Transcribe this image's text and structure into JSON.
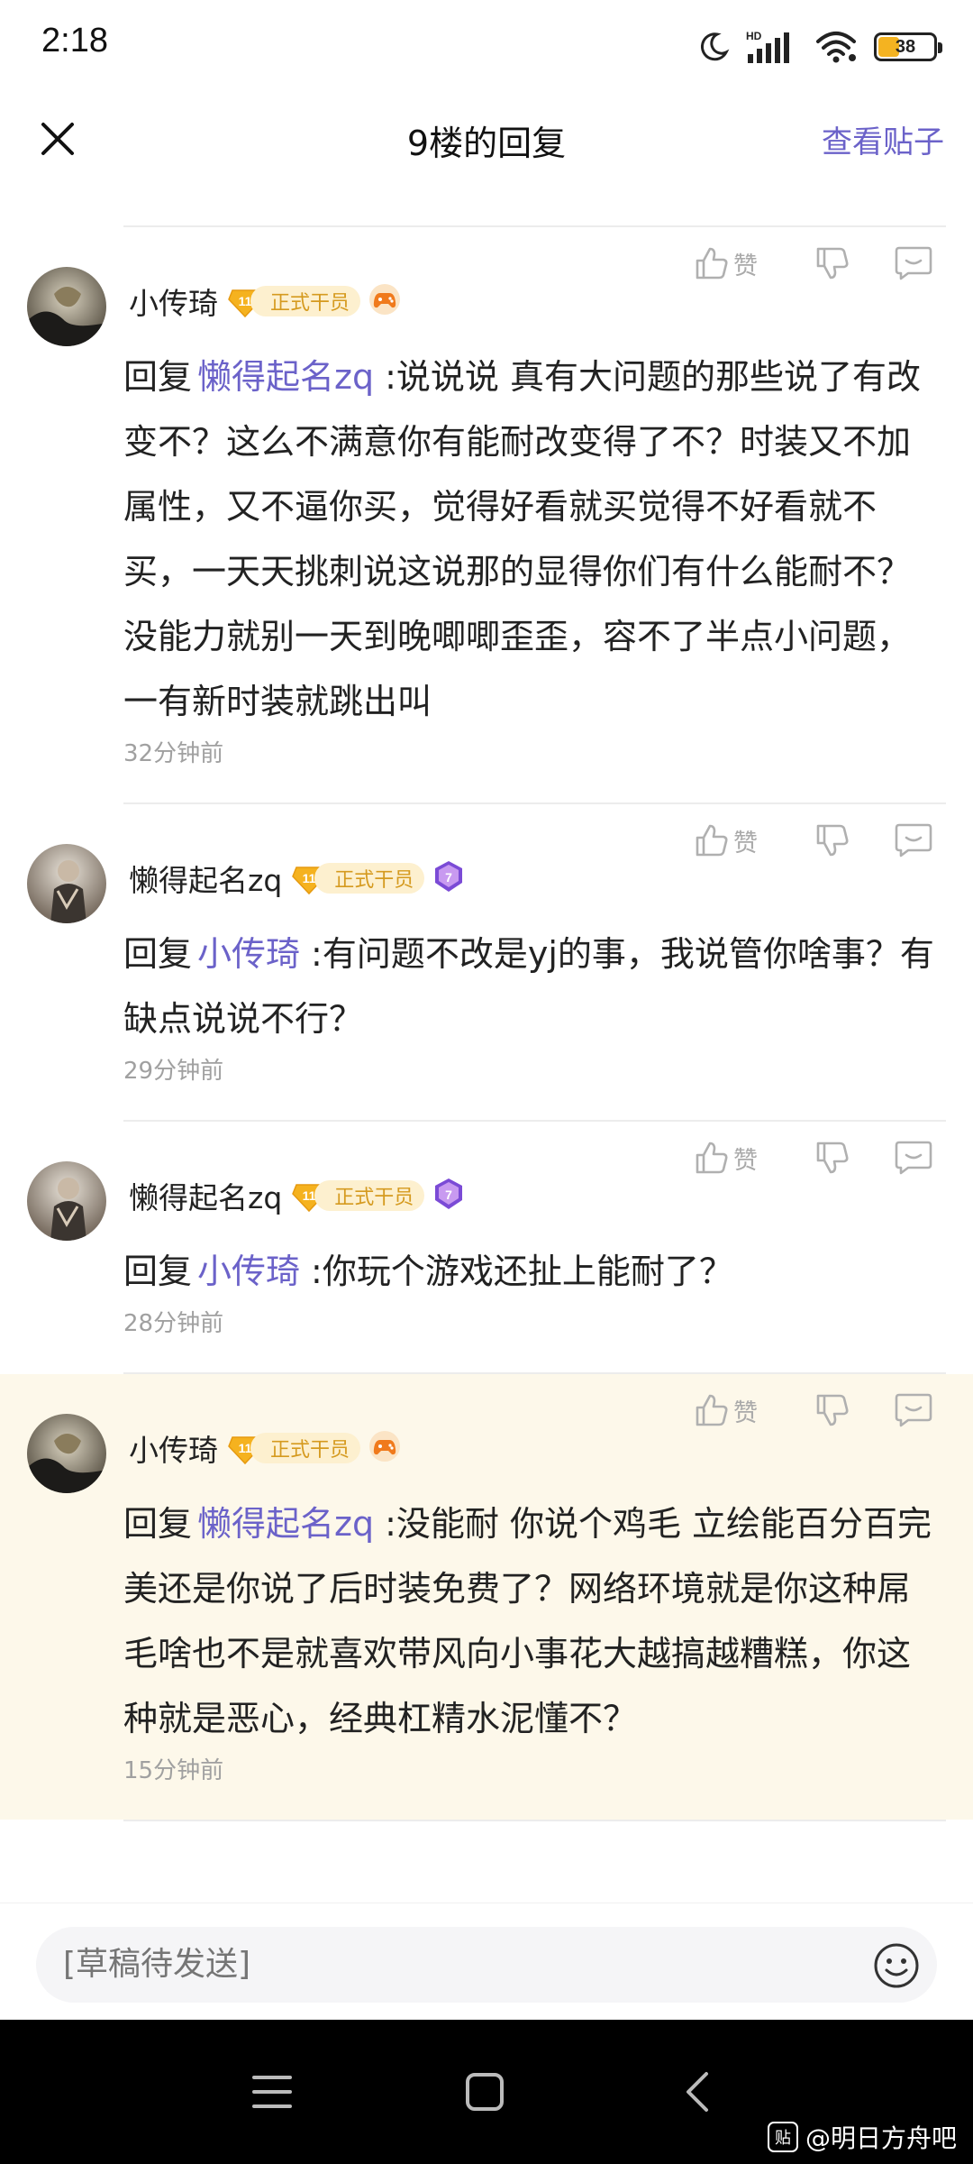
{
  "status_bar": {
    "time": "2:18",
    "network_label": "HD",
    "battery": "38",
    "battery_level": 0.38,
    "icons": [
      "moon-icon",
      "hd-signal-icon",
      "wifi-icon",
      "battery-icon"
    ]
  },
  "nav": {
    "title": "9楼的回复",
    "view_post": "查看贴子",
    "close_icon": "close-icon"
  },
  "replies": [
    {
      "username": "小传琦",
      "level": "11",
      "title_badge": "正式干员",
      "medal_icon": "gamepad-medal-icon",
      "reply_prefix": "回复",
      "mention": "懒得起名zq",
      "text": ":说说说 真有大问题的那些说了有改变不？这么不满意你有能耐改变得了不？时装又不加属性，又不逼你买，觉得好看就买觉得不好看就不买，一天天挑刺说这说那的显得你们有什么能耐不？没能力就别一天到晚唧唧歪歪，容不了半点小问题，一有新时装就跳出叫",
      "time": "32分钟前",
      "like_label": "赞"
    },
    {
      "username": "懒得起名zq",
      "level": "11",
      "title_badge": "正式干员",
      "medal_level": "7",
      "medal_icon": "level-7-medal-icon",
      "reply_prefix": "回复",
      "mention": "小传琦",
      "text": ":有问题不改是yj的事，我说管你啥事？有缺点说说不行？",
      "time": "29分钟前",
      "like_label": "赞"
    },
    {
      "username": "懒得起名zq",
      "level": "11",
      "title_badge": "正式干员",
      "medal_level": "7",
      "medal_icon": "level-7-medal-icon",
      "reply_prefix": "回复",
      "mention": "小传琦",
      "text": ":你玩个游戏还扯上能耐了？",
      "time": "28分钟前",
      "like_label": "赞"
    },
    {
      "username": "小传琦",
      "level": "11",
      "title_badge": "正式干员",
      "medal_icon": "gamepad-medal-icon",
      "reply_prefix": "回复",
      "mention": "懒得起名zq",
      "text": ":没能耐 你说个鸡毛 立绘能百分百完美还是你说了后时装免费了？网络环境就是你这种屌毛啥也不是就喜欢带风向小事花大越搞越糟糕，你这种就是恶心，经典杠精水泥懂不？",
      "time": "15分钟前",
      "like_label": "赞",
      "highlighted": true
    }
  ],
  "composer": {
    "placeholder": "[草稿待发送]",
    "emoji_icon": "emoji-icon"
  },
  "system_nav": {
    "icons": [
      "menu-icon",
      "home-icon",
      "back-icon"
    ]
  },
  "watermark": {
    "logo": "贴",
    "text": "@明日方舟吧"
  },
  "colors": {
    "accent": "#6b62c9",
    "badge_gold": "#f4b321",
    "highlight_bg": "#fdf8ea"
  }
}
